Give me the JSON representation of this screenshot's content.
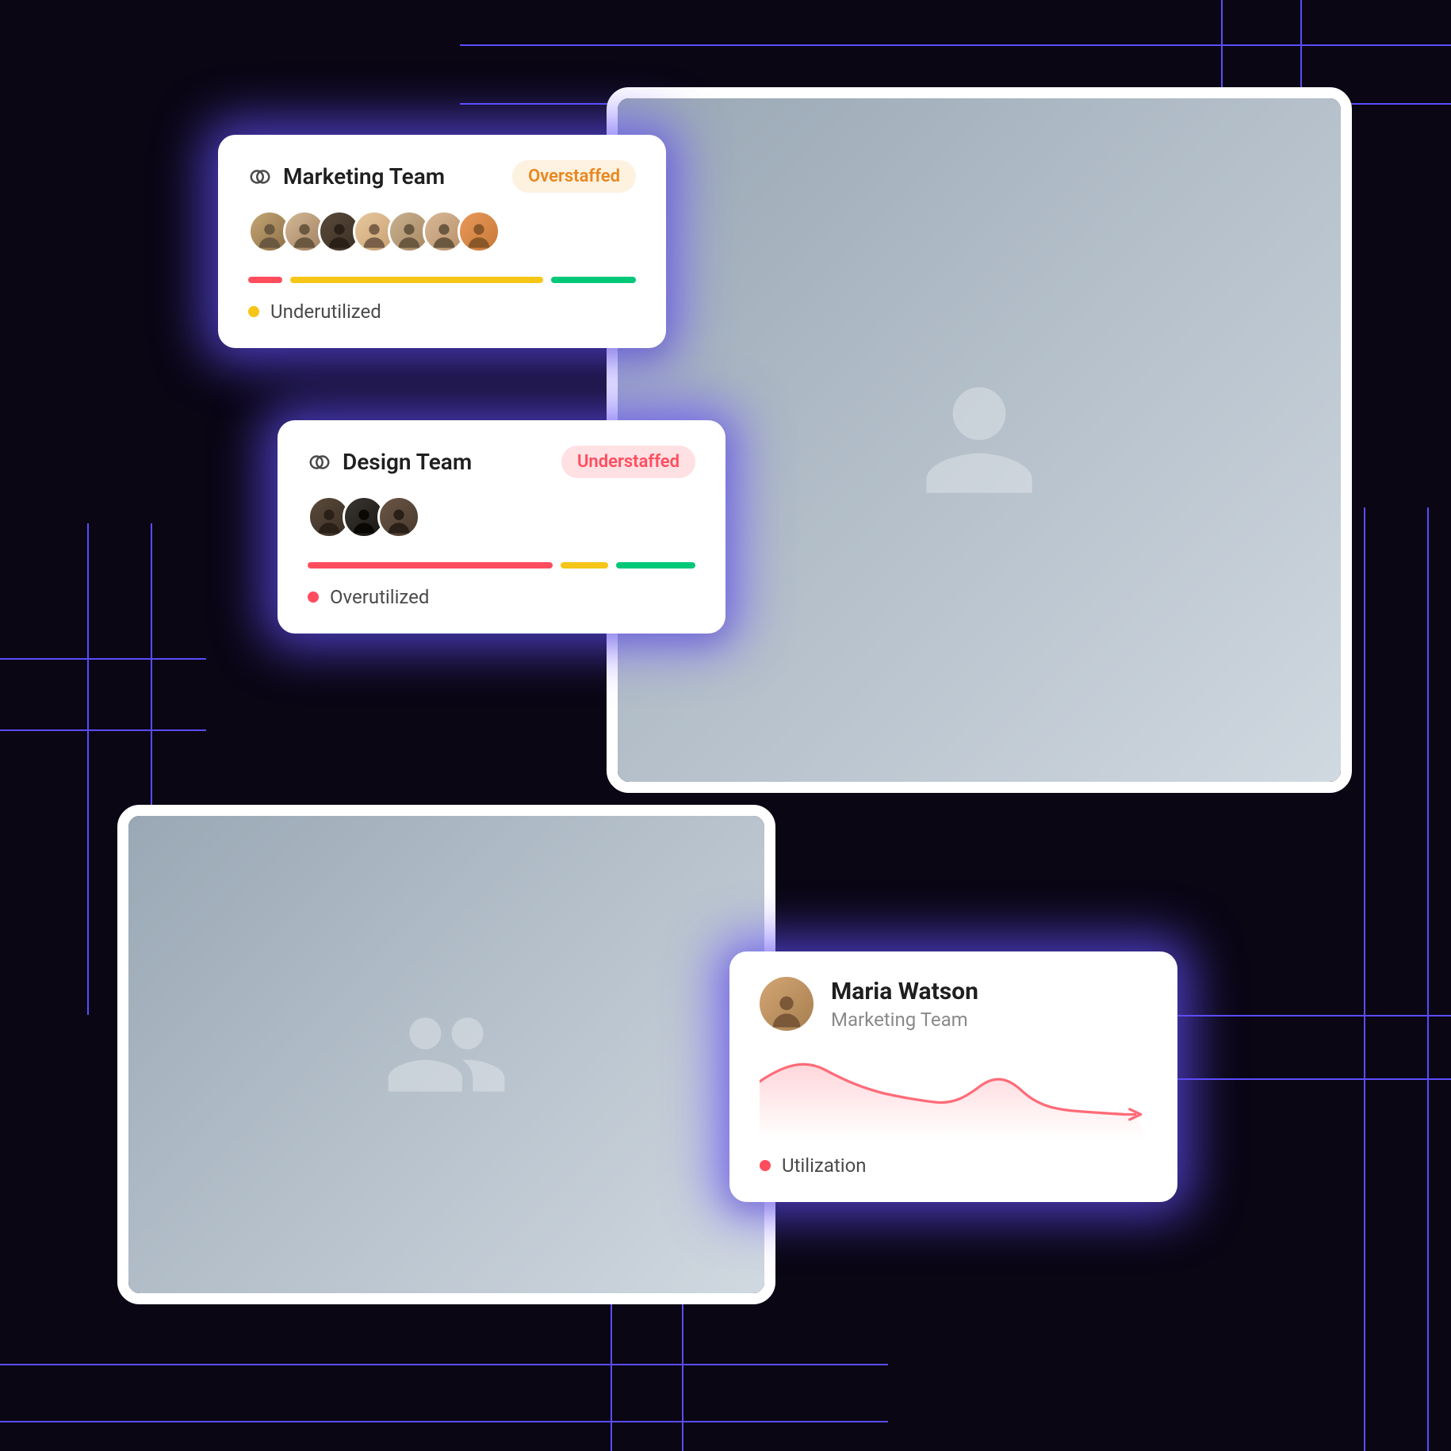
{
  "teams": {
    "marketing": {
      "icon": "overlapping-circles-icon",
      "name": "Marketing Team",
      "badge_label": "Overstaffed",
      "badge_type": "over",
      "avatar_count": 7,
      "bar_segments": [
        {
          "color": "red",
          "flex": 8
        },
        {
          "color": "yellow",
          "flex": 60
        },
        {
          "color": "green",
          "flex": 20
        }
      ],
      "status_dot_color": "yellow",
      "status_label": "Underutilized"
    },
    "design": {
      "icon": "overlapping-circles-icon",
      "name": "Design Team",
      "badge_label": "Understaffed",
      "badge_type": "under",
      "avatar_count": 3,
      "bar_segments": [
        {
          "color": "red",
          "flex": 62
        },
        {
          "color": "yellow",
          "flex": 12
        },
        {
          "color": "green",
          "flex": 20
        }
      ],
      "status_dot_color": "red",
      "status_label": "Overutilized"
    }
  },
  "person": {
    "name": "Maria Watson",
    "team": "Marketing Team",
    "metric_dot_color": "red",
    "metric_label": "Utilization"
  },
  "colors": {
    "purple_glow": "#6752ff",
    "grid_line": "#5b4cff",
    "red": "#ff4d5e",
    "yellow": "#f5c518",
    "green": "#00c878"
  },
  "chart_data": {
    "type": "line",
    "title": "",
    "xlabel": "",
    "ylabel": "",
    "series": [
      {
        "name": "Utilization",
        "values": [
          60,
          72,
          58,
          50,
          44,
          42,
          40,
          46,
          58,
          54,
          40,
          34,
          32,
          30,
          28
        ]
      }
    ],
    "ylim": [
      0,
      100
    ]
  }
}
